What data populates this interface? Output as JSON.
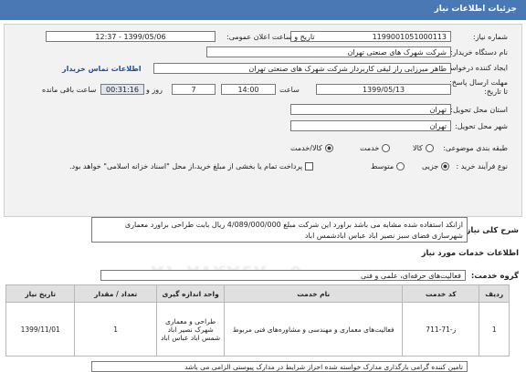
{
  "title": "جزئیات اطلاعات نیاز",
  "labels": {
    "need_number": "شماره نیاز:",
    "announce": "تاریخ و ساعت اعلان عمومی:",
    "buyer": "نام دستگاه خریدار:",
    "creator": "ایجاد کننده درخواست:",
    "deadline": "مهلت ارسال پاسخ:\nتا تاریخ:",
    "time": "ساعت",
    "days": "روز و",
    "remaining": "ساعت باقی مانده",
    "province": "استان محل تحویل:",
    "city": "شهر محل تحویل:",
    "category": "طبقه بندی موضوعی:",
    "process": "نوع فرآیند خرید :",
    "general_desc": "شرح کلی نیاز:",
    "services_info": "اطلاعات خدمات مورد نیاز",
    "service_group": "گروه خدمت:"
  },
  "need_number": "1199001051000113",
  "announce_datetime": "1399/05/06 - 12:37",
  "buyer_name": "شرکت شهرک های صنعتی تهران",
  "creator_name": "طاهر  میرزایی راز لیقی کاربرداز  شرکت شهرک های صنعتی تهران",
  "contact_link": "اطلاعات تماس خریدار",
  "deadline_date": "1399/05/13",
  "deadline_time": "14:00",
  "days": "7",
  "remaining_time": "00:31:16",
  "province": "تهران",
  "city": "تهران",
  "category_options": [
    "کالا",
    "خدمت",
    "کالا/خدمت"
  ],
  "category_selected": "کالا/خدمت",
  "process_options": [
    "جزیی",
    "متوسط"
  ],
  "process_selected": "جزیی",
  "payment_note": "پرداخت تمام یا بخشی از مبلغ خرید،از محل \"اسناد خزانه اسلامی\" خواهد بود.",
  "description": "ازانکد استفاده شده مشابه می باشد براورد این شرکت مبلغ 4/089/000/000 ریال بابت طراحی براورد معماری شهرسازی فضای سبز  نصیر اباد  عباس ابادشمس اباد",
  "service_group": "فعالیت‌های حرفه‌ای، علمی و فنی",
  "watermark": "۰۲۱-۲۸۴۲۶۷۰-۵",
  "table": {
    "headers": [
      "ردیف",
      "کد خدمت",
      "نام خدمت",
      "واحد اندازه گیری",
      "تعداد / مقدار",
      "تاریخ نیاز"
    ],
    "rows": [
      [
        "1",
        "ز-71-711",
        "فعالیت‌های معماری و مهندسی و مشاوره‌های فنی مربوط",
        "طراحی و معماری شهرک نصیر اباد شمس اباد عباس اباد",
        "1",
        "1399/11/01"
      ]
    ]
  },
  "footer_note": "تامین کننده گرامی بارگذاری مدارک خواسته شده احراز شرایط  در مدارک پیوستی الزامی می باشد"
}
